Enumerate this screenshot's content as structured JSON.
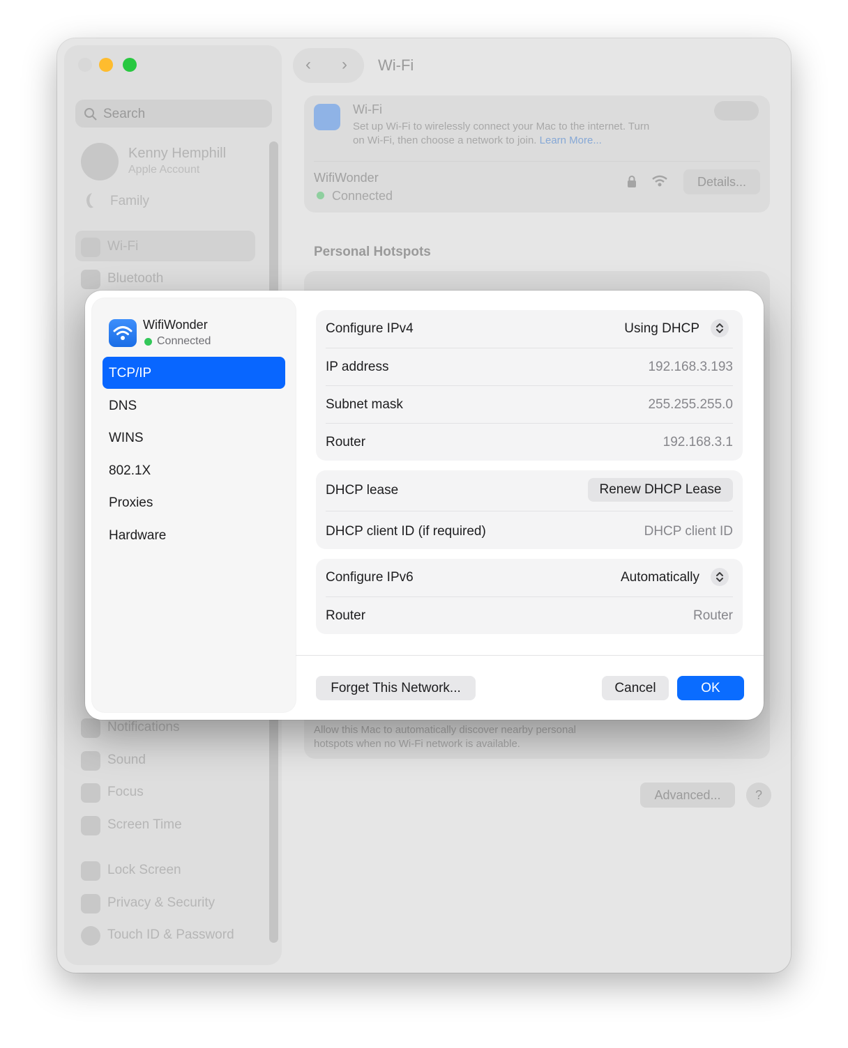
{
  "window": {
    "title": "Wi-Fi",
    "nav_back": "‹",
    "nav_forward": "›"
  },
  "sidebar": {
    "search_placeholder": "Search",
    "profile_name": "Kenny Hemphill",
    "profile_sub": "Apple Account",
    "family": "Family",
    "items_top": [
      {
        "label": "Wi-Fi"
      },
      {
        "label": "Bluetooth"
      }
    ],
    "items_bottom": [
      {
        "label": "Notifications"
      },
      {
        "label": "Sound"
      },
      {
        "label": "Focus"
      },
      {
        "label": "Screen Time"
      },
      {
        "label": "Lock Screen"
      },
      {
        "label": "Privacy & Security"
      },
      {
        "label": "Touch ID & Password"
      }
    ]
  },
  "wifi_panel": {
    "title": "Wi-Fi",
    "description_line1": "Set up Wi-Fi to wirelessly connect your Mac to the internet. Turn",
    "description_line2": "on Wi-Fi, then choose a network to join.",
    "learn_more": "Learn More...",
    "network_name": "WifiWonder",
    "network_status": "Connected",
    "details_button": "Details..."
  },
  "background": {
    "section_title": "Personal Hotspots",
    "hotspot_note_line1": "Allow this Mac to automatically discover nearby personal",
    "hotspot_note_line2": "hotspots when no Wi-Fi network is available.",
    "advanced_button": "Advanced...",
    "help_button": "?"
  },
  "dialog": {
    "network_name": "WifiWonder",
    "network_status": "Connected",
    "tabs": [
      {
        "label": "TCP/IP",
        "active": true
      },
      {
        "label": "DNS"
      },
      {
        "label": "WINS"
      },
      {
        "label": "802.1X"
      },
      {
        "label": "Proxies"
      },
      {
        "label": "Hardware"
      }
    ],
    "ipv4": {
      "configure_label": "Configure IPv4",
      "configure_value": "Using DHCP",
      "ip_label": "IP address",
      "ip_value": "192.168.3.193",
      "subnet_label": "Subnet mask",
      "subnet_value": "255.255.255.0",
      "router_label": "Router",
      "router_value": "192.168.3.1"
    },
    "dhcp": {
      "lease_label": "DHCP lease",
      "renew_button": "Renew DHCP Lease",
      "client_id_label": "DHCP client ID (if required)",
      "client_id_placeholder": "DHCP client ID"
    },
    "ipv6": {
      "configure_label": "Configure IPv6",
      "configure_value": "Automatically",
      "router_label": "Router",
      "router_placeholder": "Router"
    },
    "buttons": {
      "forget": "Forget This Network...",
      "cancel": "Cancel",
      "ok": "OK"
    }
  },
  "colors": {
    "accent": "#0866ff",
    "status_green": "#33c759",
    "traffic_yellow": "#febc2e",
    "traffic_green": "#28c840"
  }
}
